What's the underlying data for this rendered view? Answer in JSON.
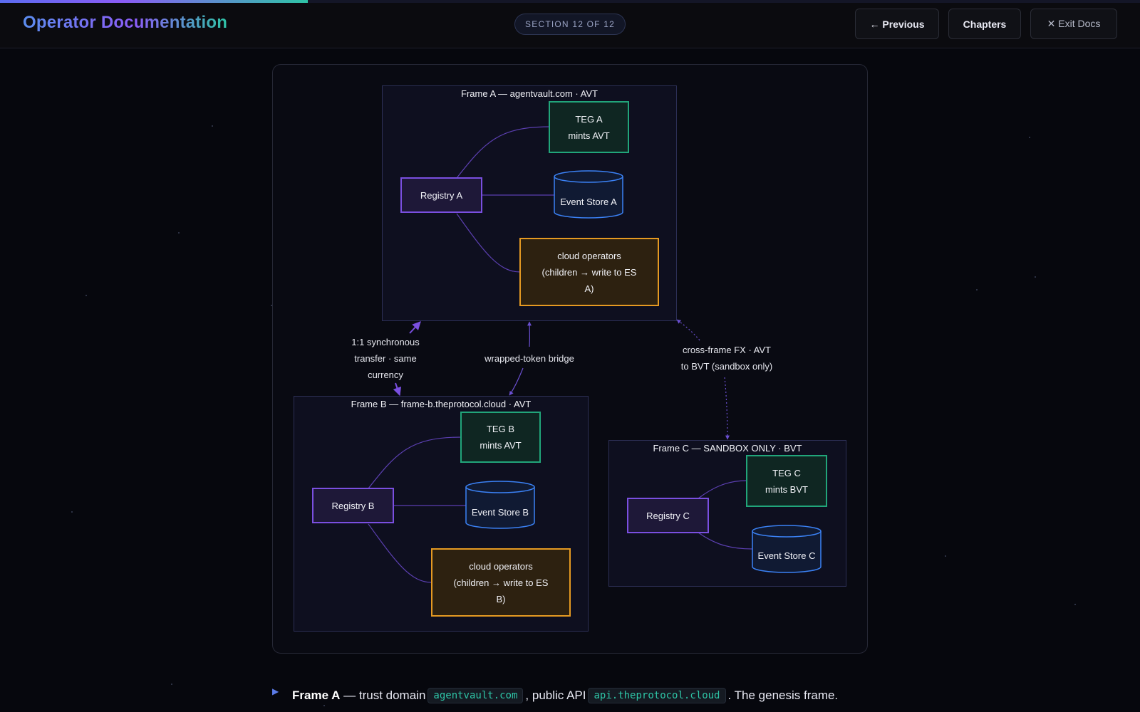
{
  "header": {
    "brand": "Operator Documentation",
    "section_pill": "SECTION 12 OF 12",
    "progress": 0.27,
    "buttons": {
      "previous": "← Previous",
      "chapters": "Chapters",
      "exit": "✕ Exit Docs"
    }
  },
  "diagram": {
    "frame_a": {
      "title": "Frame A — agentvault.com · AVT",
      "teg_line1": "TEG A",
      "teg_line2": "mints AVT",
      "registry": "Registry A",
      "event_store": "Event Store A",
      "ops_line1": "cloud operators",
      "ops_line2": "(children → write to ES",
      "ops_line3": "A)"
    },
    "frame_b": {
      "title": "Frame B — frame-b.theprotocol.cloud · AVT",
      "teg_line1": "TEG B",
      "teg_line2": "mints AVT",
      "registry": "Registry B",
      "event_store": "Event Store B",
      "ops_line1": "cloud operators",
      "ops_line2": "(children → write to ES",
      "ops_line3": "B)"
    },
    "frame_c": {
      "title": "Frame C — SANDBOX ONLY · BVT",
      "teg_line1": "TEG C",
      "teg_line2": "mints BVT",
      "registry": "Registry C",
      "event_store": "Event Store C"
    },
    "edges": {
      "sync_line1": "1:1 synchronous",
      "sync_line2": "transfer · same",
      "sync_line3": "currency",
      "bridge": "wrapped-token bridge",
      "fx_line1": "cross-frame FX · AVT",
      "fx_line2": "to BVT (sandbox only)"
    }
  },
  "body": {
    "frame_a_label": "Frame A",
    "text1": " — trust domain",
    "domain_code": "agentvault.com",
    "text2": ", public API",
    "api_code": "api.theprotocol.cloud",
    "text3": ". The genesis frame."
  },
  "colors": {
    "registry": "#7a4fe0",
    "teg": "#21a57a",
    "event_store": "#3b82f6",
    "operators": "#e59a22",
    "accent": "#8b5cf6",
    "code": "#2ec4a6"
  }
}
